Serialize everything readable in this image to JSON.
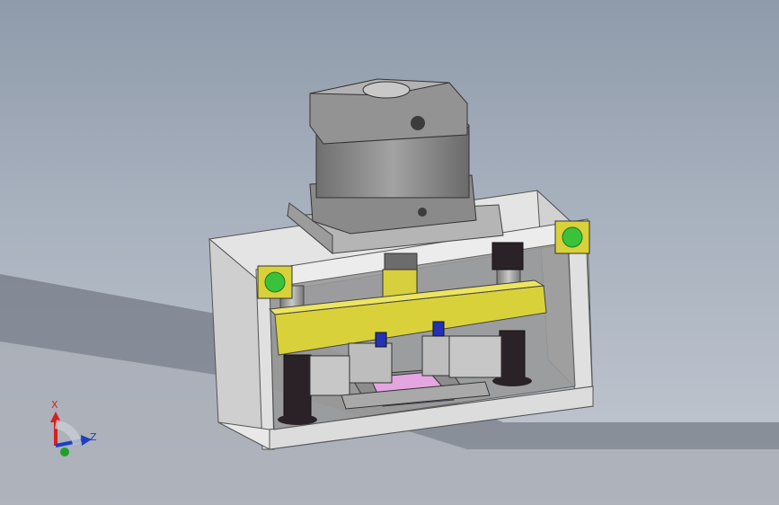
{
  "triad": {
    "x_label": "X",
    "z_label": "Z",
    "x_color": "#d62020",
    "z_color": "#1f3fbf",
    "y_color": "#1fa02b"
  },
  "colors": {
    "frame": "#d8d8d8",
    "cylinder": "#8a8a8a",
    "yoke": "#d9d13a",
    "indicator": "#39c23a",
    "fixture": "#b9a8d6",
    "guide": "#2a2226",
    "handle": "#2431b5"
  }
}
